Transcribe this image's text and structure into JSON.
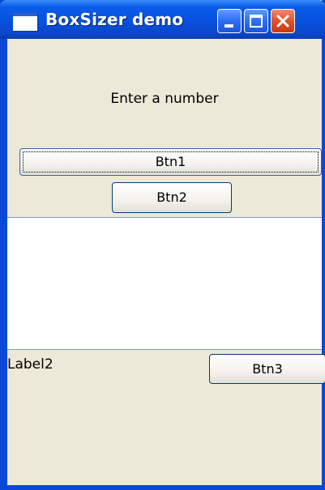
{
  "window": {
    "title": "BoxSizer demo"
  },
  "caption_buttons": {
    "minimize_icon": "minimize-icon",
    "maximize_icon": "maximize-icon",
    "close_icon": "close-icon"
  },
  "top_section": {
    "label": "Enter a number",
    "btn1_label": "Btn1",
    "btn2_label": "Btn2"
  },
  "bottom_section": {
    "label": "Label2",
    "btn3_label": "Btn3"
  },
  "colors": {
    "titlebar": "#0751df",
    "frame": "#0a48d6",
    "client_bg": "#ece9d8",
    "close_button": "#e2512a",
    "panel_bg": "#ffffff"
  }
}
